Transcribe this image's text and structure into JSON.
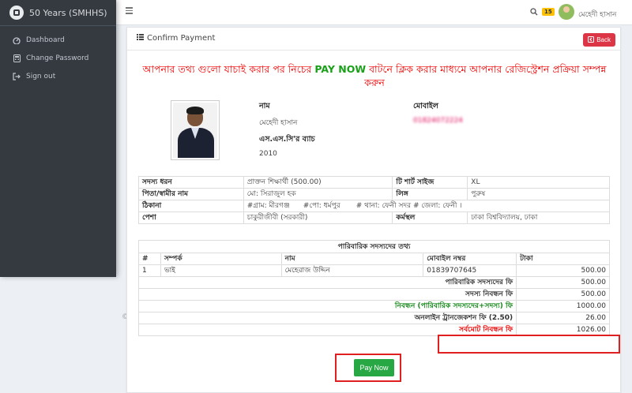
{
  "sidebar": {
    "brand": "50 Years (SMHHS)",
    "items": [
      {
        "label": "Dashboard",
        "icon": "dashboard-icon"
      },
      {
        "label": "Change Password",
        "icon": "calculator-icon"
      },
      {
        "label": "Sign out",
        "icon": "sign-out-icon"
      }
    ]
  },
  "topbar": {
    "notification_count": "15",
    "user_name": "মেহেদী হাসান"
  },
  "card": {
    "title": "Confirm Payment",
    "back_label": "Back",
    "notice_part1": "আপনার তথ্য গুলো যাচাই করার পর নিচের ",
    "notice_pay": "PAY NOW",
    "notice_part2": " বাটনে ক্লিক করার মাধ্যমে আপনার রেজিস্ট্রেশন প্রক্রিয়া সম্পন্ন করুন"
  },
  "profile": {
    "name_label": "নাম",
    "name_value": "মেহেদী হাসান",
    "mobile_label": "মোবাইল",
    "mobile_value": "01824072224",
    "batch_label": "এস.এস.সি'র ব্যাচ",
    "batch_value": "2010"
  },
  "details": {
    "member_type_label": "সদস্য ধরন",
    "member_type_value": "প্রাক্তন শিক্ষার্থী (500.00)",
    "tshirt_label": "টি শার্ট সাইজ",
    "tshirt_value": "XL",
    "parent_label": "পিতা/স্বামীর নাম",
    "parent_value": "মো: সিরাজুল হক",
    "gender_label": "লিঙ্গ",
    "gender_value": "পুরুষ",
    "address_label": "ঠিকানা",
    "address_value": "#গ্রাম: মীরগঞ্জ      #পো: ধর্মপুর       # থানা: ফেনী সদর # জেলা: ফেনী ।",
    "occupation_label": "পেশা",
    "occupation_value": "চাকুরীজীবী (সরকারী)",
    "workplace_label": "কর্মস্থল",
    "workplace_value": "ঢাকা বিশ্ববিদ্যালয়, ঢাকা"
  },
  "family": {
    "caption": "পারিবারিক সদস্যদের তথ্য",
    "headers": [
      "#",
      "সম্পর্ক",
      "নাম",
      "মোবাইল নম্বর",
      "টাকা"
    ],
    "rows": [
      {
        "no": "1",
        "relation": "ভাই",
        "name": "মেহেরাজ উদ্দিন",
        "mobile": "01839707645",
        "amount": "500.00"
      }
    ],
    "summary": [
      {
        "label": "পারিবারিক সদস্যদের ফি",
        "value": "500.00"
      },
      {
        "label": "সদস্য নিবন্ধন ফি",
        "value": "500.00"
      },
      {
        "label": "নিবন্ধন (পারিবারিক সদস্যদের+সদস্য) ফি",
        "value": "1000.00"
      },
      {
        "label": "অনলাইন ট্রানজেকশন ফি (2.50)",
        "value": "26.00"
      },
      {
        "label": "সর্বমোট নিবন্ধন ফি",
        "value": "1026.00"
      }
    ]
  },
  "pay_button": "Pay Now",
  "footer_glyph": "©",
  "colors": {
    "sidebar": "#343a40",
    "danger": "#dc3545",
    "success": "#28a745",
    "notice": "#ee0000"
  }
}
